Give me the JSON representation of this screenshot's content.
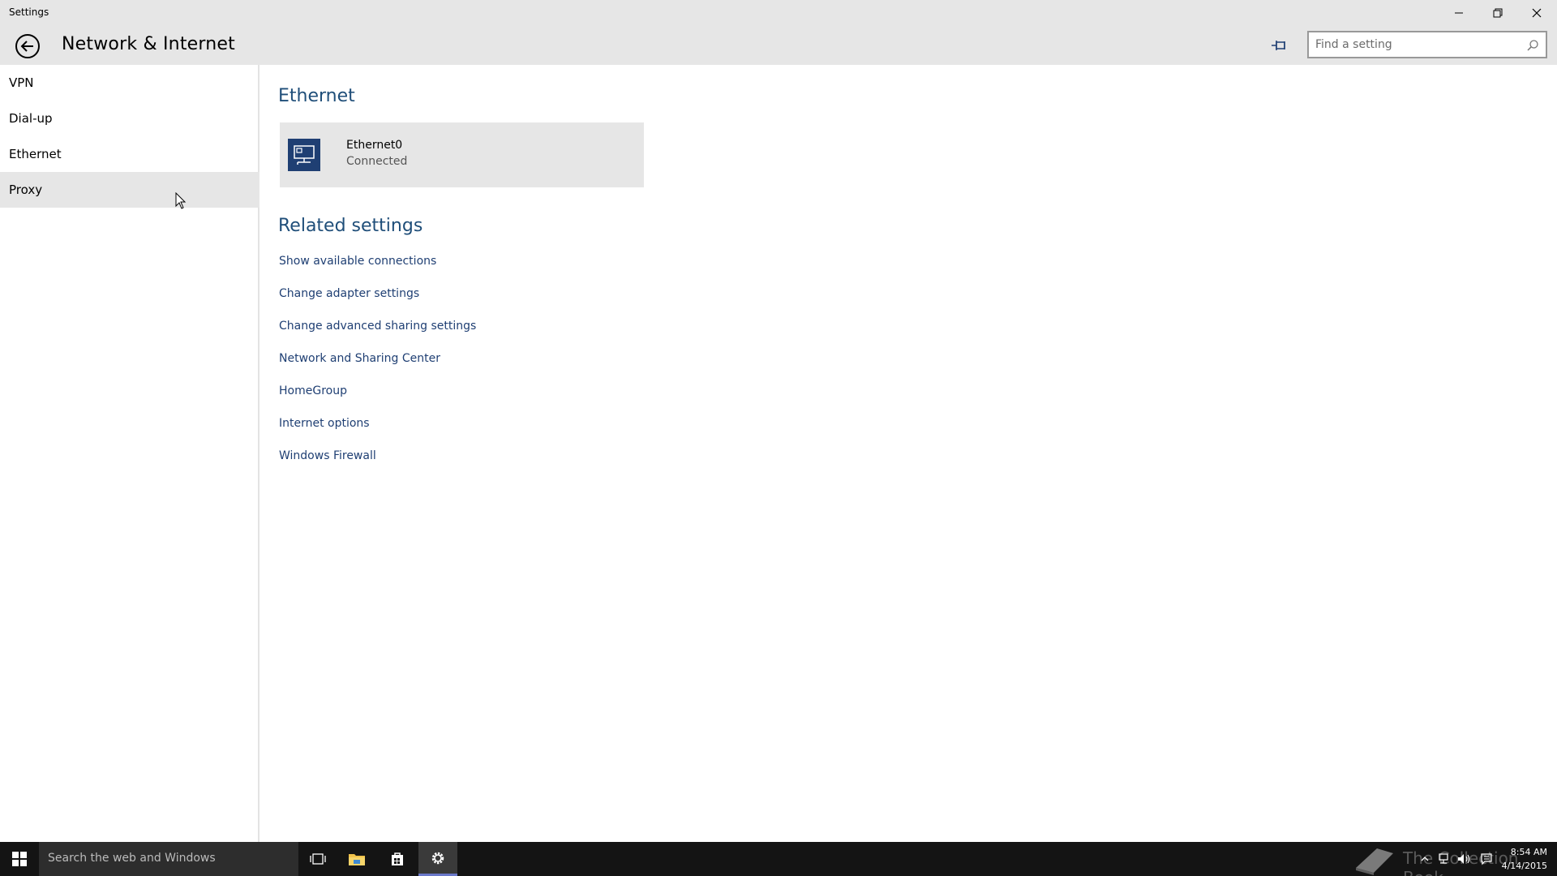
{
  "window": {
    "title": "Settings",
    "controls": {
      "minimize": "minimize",
      "maximize": "restore",
      "close": "close"
    }
  },
  "header": {
    "title": "Network & Internet",
    "search_placeholder": "Find a setting"
  },
  "sidebar": {
    "items": [
      {
        "label": "VPN"
      },
      {
        "label": "Dial-up"
      },
      {
        "label": "Ethernet"
      },
      {
        "label": "Proxy"
      }
    ],
    "hovered_index": 3
  },
  "main": {
    "ethernet_title": "Ethernet",
    "adapter": {
      "name": "Ethernet0",
      "status": "Connected"
    },
    "related_title": "Related settings",
    "related_links": [
      "Show available connections",
      "Change adapter settings",
      "Change advanced sharing settings",
      "Network and Sharing Center",
      "HomeGroup",
      "Internet options",
      "Windows Firewall"
    ]
  },
  "taskbar": {
    "search_placeholder": "Search the web and Windows",
    "watermark": "The Collection Book",
    "clock": {
      "time": "8:54 AM",
      "date": "4/14/2015"
    }
  },
  "colors": {
    "accent": "#1f3f73",
    "chrome": "#e6e6e6",
    "taskbar": "#141414",
    "taskbar_search": "#2d2d2d"
  }
}
